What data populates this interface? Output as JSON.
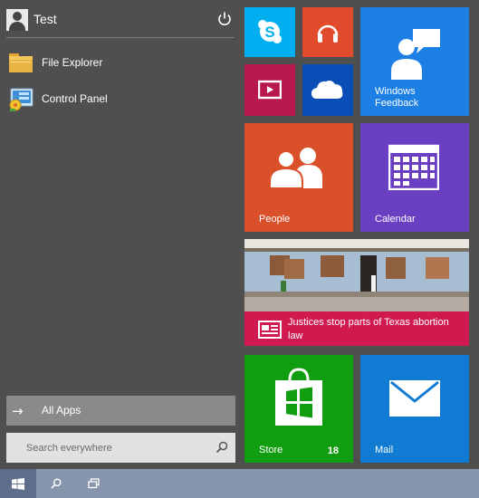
{
  "user": {
    "name": "Test",
    "power_icon": "power-icon",
    "avatar_icon": "user-avatar-icon"
  },
  "apps": [
    {
      "label": "File Explorer",
      "icon": "folder-icon"
    },
    {
      "label": "Control Panel",
      "icon": "control-panel-icon"
    }
  ],
  "all_apps": {
    "label": "All Apps",
    "icon": "arrow-right-icon"
  },
  "search": {
    "placeholder": "Search everywhere",
    "icon": "search-icon"
  },
  "tiles": {
    "skype": {
      "color": "#00aff0",
      "icon": "skype-icon"
    },
    "music": {
      "color": "#e14b2b",
      "icon": "headphones-icon"
    },
    "feedback": {
      "label": "Windows Feedback",
      "color": "#1b7fe3",
      "icon": "feedback-people-icon"
    },
    "video": {
      "color": "#b8194d",
      "icon": "video-icon"
    },
    "onedrive": {
      "color": "#0a4db7",
      "icon": "cloud-icon"
    },
    "people": {
      "label": "People",
      "color": "#d9502a",
      "icon": "people-icon"
    },
    "calendar": {
      "label": "Calendar",
      "color": "#6b3fc2",
      "icon": "calendar-icon"
    },
    "news": {
      "headline": "Justices stop parts of Texas abortion law",
      "color": "#d01a4f",
      "icon": "news-icon"
    },
    "store": {
      "label": "Store",
      "badge": "18",
      "color": "#109e10",
      "icon": "store-bag-icon"
    },
    "mail": {
      "label": "Mail",
      "color": "#0f7bd3",
      "icon": "mail-icon"
    }
  },
  "taskbar": {
    "start_icon": "windows-logo-icon",
    "search_icon": "search-icon",
    "task_view_icon": "task-view-icon"
  }
}
